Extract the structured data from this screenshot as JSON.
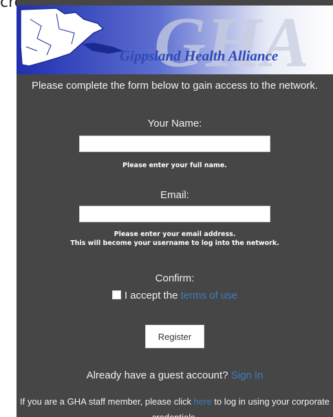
{
  "page": {
    "top_fragment": "creen."
  },
  "header": {
    "logo_text": "GHA",
    "organization": "Gippsland Health Alliance"
  },
  "form": {
    "intro": "Please complete the form below to gain access to the network.",
    "name_label": "Your Name:",
    "name_value": "",
    "name_hint": "Please enter your full name.",
    "email_label": "Email:",
    "email_value": "",
    "email_hint_line1": "Please enter your email address.",
    "email_hint_line2": "This will become your username to log into the network.",
    "confirm_label": "Confirm:",
    "accept_text": "I accept the",
    "terms_link": "terms of use",
    "register_button": "Register"
  },
  "footer": {
    "guest_text": "Already have a guest account?",
    "signin_link": "Sign In",
    "staff_text_before": "If you are a GHA staff member, please click",
    "staff_link": "here",
    "staff_text_after": "to log in using your corporate credentials."
  },
  "colors": {
    "panel_bg": "#464646",
    "link": "#3a7fc2",
    "brand_blue": "#2e48b8"
  }
}
